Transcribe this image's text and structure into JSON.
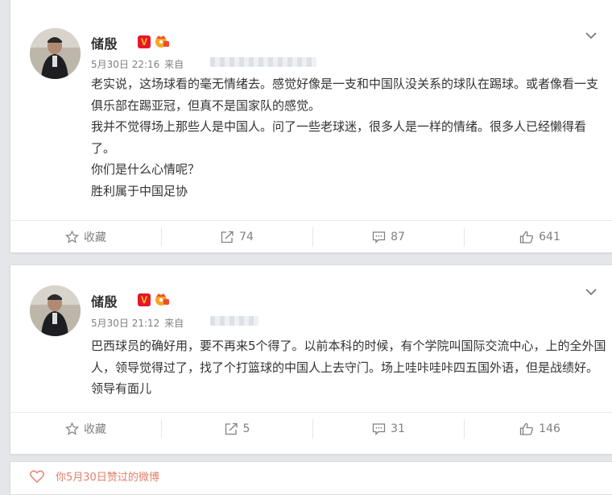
{
  "posts": [
    {
      "author": "储殷",
      "time": "5月30日 22:16",
      "source_prefix": "来自",
      "paragraphs": [
        "老实说，这场球看的毫无情绪去。感觉好像是一支和中国队没关系的球队在踢球。或者像看一支俱乐部在踢亚冠，但真不是国家队的感觉。",
        "我并不觉得场上那些人是中国人。问了一些老球迷，很多人是一样的情绪。很多人已经懒得看了。",
        "你们是什么心情呢？",
        "胜利属于中国足协"
      ],
      "actions": {
        "favorite": "收藏",
        "repost": "74",
        "comment": "87",
        "like": "641"
      }
    },
    {
      "author": "储殷",
      "time": "5月30日 21:12",
      "source_prefix": "来自",
      "paragraphs": [
        "巴西球员的确好用，要不再来5个得了。以前本科的时候，有个学院叫国际交流中心，上的全外国人，领导觉得过了，找了个打篮球的中国人上去守门。场上哇咔哇咔四五国外语，但是战绩好。领导有面儿"
      ],
      "actions": {
        "favorite": "收藏",
        "repost": "5",
        "comment": "31",
        "like": "146"
      }
    }
  ],
  "liked_notice": "你5月30日赞过的微博",
  "badges": {
    "verified": "V"
  },
  "icons": [
    "star-icon",
    "repost-icon",
    "comment-icon",
    "thumbs-up-icon",
    "chevron-down-icon",
    "heart-icon",
    "crown-badge-icon"
  ],
  "colors": {
    "verified_bg": "#e6162d",
    "verified_text": "#ffd200",
    "liked": "#e3806b",
    "muted": "#808080"
  }
}
